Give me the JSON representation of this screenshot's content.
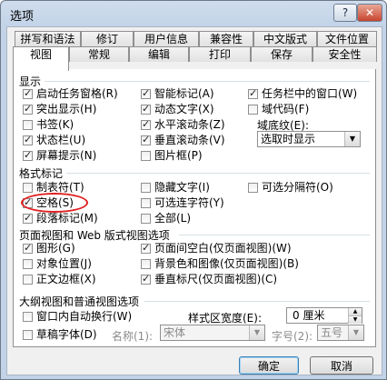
{
  "window": {
    "title": "选项",
    "help_label": "?",
    "close_label": "✕"
  },
  "tabs_row1": [
    "拼写和语法",
    "修订",
    "用户信息",
    "兼容性",
    "中文版式",
    "文件位置"
  ],
  "tabs_row2": [
    "视图",
    "常规",
    "编辑",
    "打印",
    "保存",
    "安全性"
  ],
  "display": {
    "label": "显示",
    "col1": [
      {
        "label": "启动任务窗格(R)",
        "checked": true
      },
      {
        "label": "突出显示(H)",
        "checked": true
      },
      {
        "label": "书签(K)",
        "checked": false
      },
      {
        "label": "状态栏(U)",
        "checked": true
      },
      {
        "label": "屏幕提示(N)",
        "checked": true
      }
    ],
    "col2": [
      {
        "label": "智能标记(A)",
        "checked": true
      },
      {
        "label": "动态文字(X)",
        "checked": true
      },
      {
        "label": "水平滚动条(Z)",
        "checked": true
      },
      {
        "label": "垂直滚动条(V)",
        "checked": true
      },
      {
        "label": "图片框(P)",
        "checked": false
      }
    ],
    "col3": [
      {
        "label": "任务栏中的窗口(W)",
        "checked": true
      },
      {
        "label": "域代码(F)",
        "checked": false
      }
    ],
    "shading_label": "域底纹(E):",
    "shading_value": "选取时显示"
  },
  "format_marks": {
    "label": "格式标记",
    "col1": [
      {
        "label": "制表符(T)",
        "checked": false
      },
      {
        "label": "空格(S)",
        "checked": true
      },
      {
        "label": "段落标记(M)",
        "checked": true
      }
    ],
    "col2": [
      {
        "label": "隐藏文字(I)",
        "checked": false
      },
      {
        "label": "可选连字符(Y)",
        "checked": false
      },
      {
        "label": "全部(L)",
        "checked": false
      }
    ],
    "col3": [
      {
        "label": "可选分隔符(O)",
        "checked": false
      }
    ]
  },
  "page_view": {
    "label": "页面视图和 Web 版式视图选项",
    "col1": [
      {
        "label": "图形(G)",
        "checked": true
      },
      {
        "label": "对象位置(J)",
        "checked": false
      },
      {
        "label": "正文边框(X)",
        "checked": false
      }
    ],
    "col2": [
      {
        "label": "页面间空白(仅页面视图)(W)",
        "checked": true
      },
      {
        "label": "背景色和图像(仅页面视图)(B)",
        "checked": false
      },
      {
        "label": "垂直标尺(仅页面视图)(C)",
        "checked": true
      }
    ]
  },
  "outline": {
    "label": "大纲视图和普通视图选项",
    "wrap": {
      "label": "窗口内自动换行(W)",
      "checked": false
    },
    "draft": {
      "label": "草稿字体(D)",
      "checked": false
    },
    "style_width_label": "样式区宽度(E):",
    "style_width_value": "0 厘米",
    "name_label": "名称(1):",
    "name_value": "宋体",
    "size_label": "字号(2):",
    "size_value": "五号"
  },
  "buttons": {
    "ok": "确定",
    "cancel": "取消"
  }
}
